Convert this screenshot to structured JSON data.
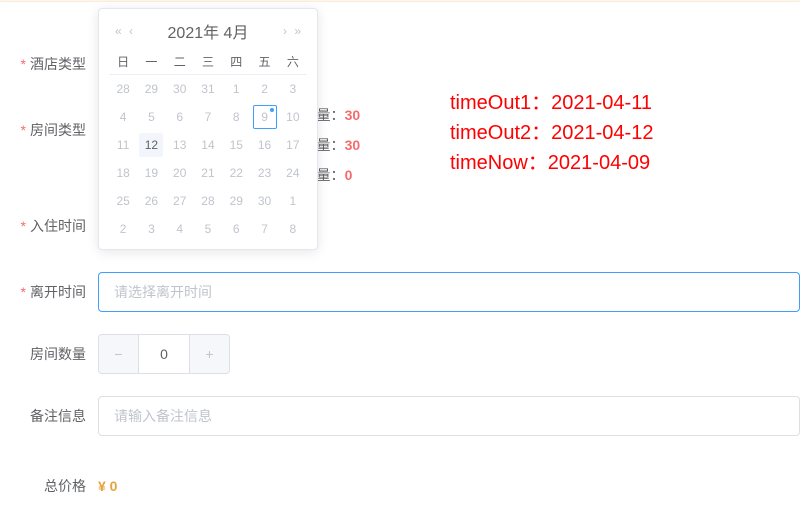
{
  "labels": {
    "hotel_type": "酒店类型",
    "room_type": "房间类型",
    "checkin": "入住时间",
    "checkout": "离开时间",
    "room_count": "房间数量",
    "remark": "备注信息",
    "total_price": "总价格"
  },
  "inputs": {
    "checkout_placeholder": "请选择离开时间",
    "remark_placeholder": "请输入备注信息"
  },
  "stepper": {
    "minus": "−",
    "plus": "+",
    "value": "0"
  },
  "price": {
    "display": "¥ 0"
  },
  "calendar": {
    "year_month": "2021年 4月",
    "weekdays": [
      "日",
      "一",
      "二",
      "三",
      "四",
      "五",
      "六"
    ],
    "rows": [
      [
        {
          "n": "28"
        },
        {
          "n": "29"
        },
        {
          "n": "30"
        },
        {
          "n": "31"
        },
        {
          "n": "1"
        },
        {
          "n": "2"
        },
        {
          "n": "3"
        }
      ],
      [
        {
          "n": "4"
        },
        {
          "n": "5"
        },
        {
          "n": "6"
        },
        {
          "n": "7"
        },
        {
          "n": "8"
        },
        {
          "n": "9",
          "today": true
        },
        {
          "n": "10"
        }
      ],
      [
        {
          "n": "11"
        },
        {
          "n": "12",
          "selected": true
        },
        {
          "n": "13"
        },
        {
          "n": "14"
        },
        {
          "n": "15"
        },
        {
          "n": "16"
        },
        {
          "n": "17"
        }
      ],
      [
        {
          "n": "18"
        },
        {
          "n": "19"
        },
        {
          "n": "20"
        },
        {
          "n": "21"
        },
        {
          "n": "22"
        },
        {
          "n": "23"
        },
        {
          "n": "24"
        }
      ],
      [
        {
          "n": "25"
        },
        {
          "n": "26"
        },
        {
          "n": "27"
        },
        {
          "n": "28"
        },
        {
          "n": "29"
        },
        {
          "n": "30"
        },
        {
          "n": "1"
        }
      ],
      [
        {
          "n": "2"
        },
        {
          "n": "3"
        },
        {
          "n": "4"
        },
        {
          "n": "5"
        },
        {
          "n": "6"
        },
        {
          "n": "7"
        },
        {
          "n": "8"
        }
      ]
    ],
    "nav": {
      "prev_year": "«",
      "prev_month": "‹",
      "next_month": "›",
      "next_year": "»"
    }
  },
  "availability_label": "可预订数量：",
  "availability": [
    {
      "count": "30"
    },
    {
      "count": "30"
    },
    {
      "count": "0"
    }
  ],
  "debug": {
    "l1": "timeOut1：2021-04-11",
    "l2": "timeOut2：2021-04-12",
    "l3": "timeNow：2021-04-09"
  }
}
